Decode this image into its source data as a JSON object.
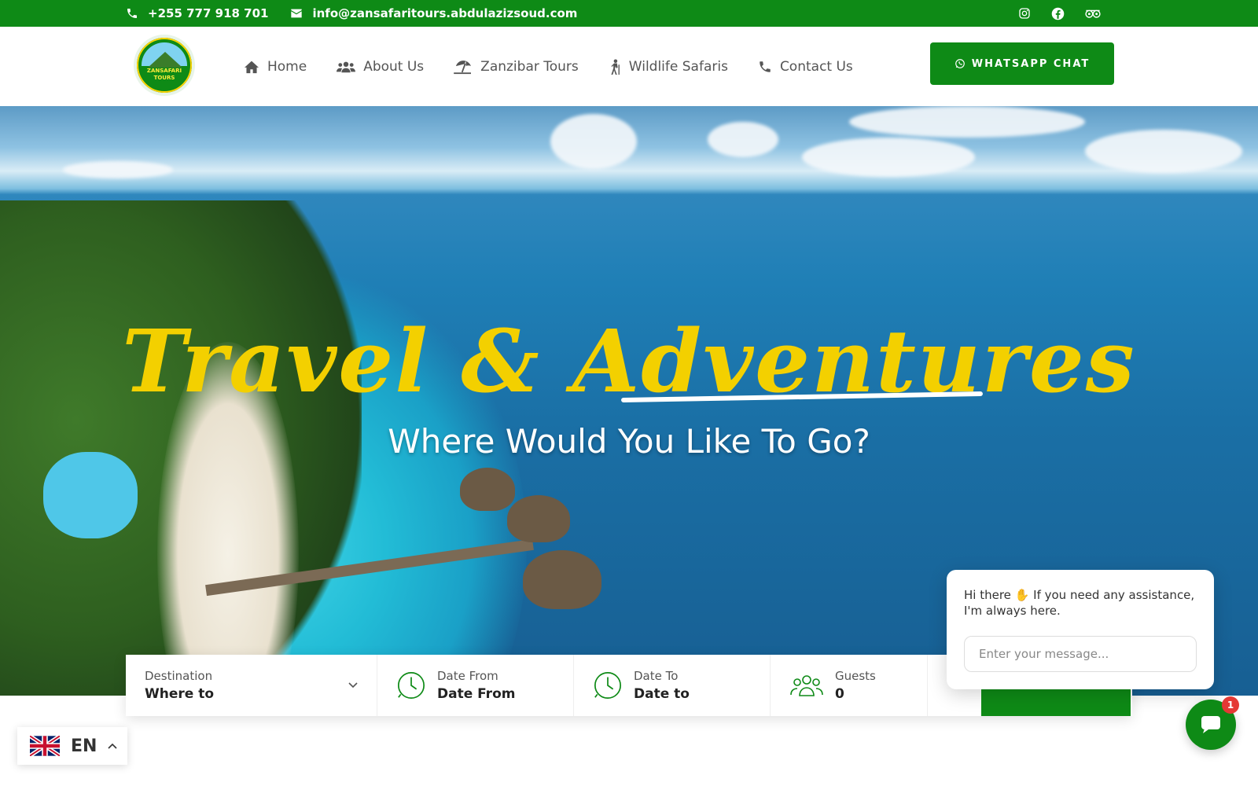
{
  "topbar": {
    "phone": "+255 777 918 701",
    "email": "info@zansafaritours.abdulazizsoud.com",
    "social": [
      "instagram-icon",
      "facebook-icon",
      "tripadvisor-icon"
    ]
  },
  "brand": {
    "logo_text": "ZANSAFARI TOURS"
  },
  "nav": {
    "items": [
      {
        "label": "Home",
        "icon": "home-icon"
      },
      {
        "label": "About Us",
        "icon": "users-icon"
      },
      {
        "label": "Zanzibar Tours",
        "icon": "beach-umbrella-icon"
      },
      {
        "label": "Wildlife Safaris",
        "icon": "hiker-icon"
      },
      {
        "label": "Contact Us",
        "icon": "phone-icon"
      }
    ],
    "whatsapp_label": "WHATSAPP CHAT"
  },
  "hero": {
    "script_title": "Travel & Adventures",
    "subtitle": "Where Would You Like To Go?"
  },
  "search": {
    "destination": {
      "label": "Destination",
      "value": "Where to"
    },
    "date_from": {
      "label": "Date From",
      "value": "Date From"
    },
    "date_to": {
      "label": "Date To",
      "value": "Date to"
    },
    "guests": {
      "label": "Guests",
      "value": "0"
    }
  },
  "chat": {
    "greeting_prefix": "Hi there",
    "greeting_suffix": "If you need any assistance, I'm always here.",
    "input_placeholder": "Enter your message...",
    "badge_count": "1"
  },
  "language": {
    "code": "EN"
  },
  "colors": {
    "brand_green": "#0e8a16",
    "script_yellow": "#f3d000"
  }
}
